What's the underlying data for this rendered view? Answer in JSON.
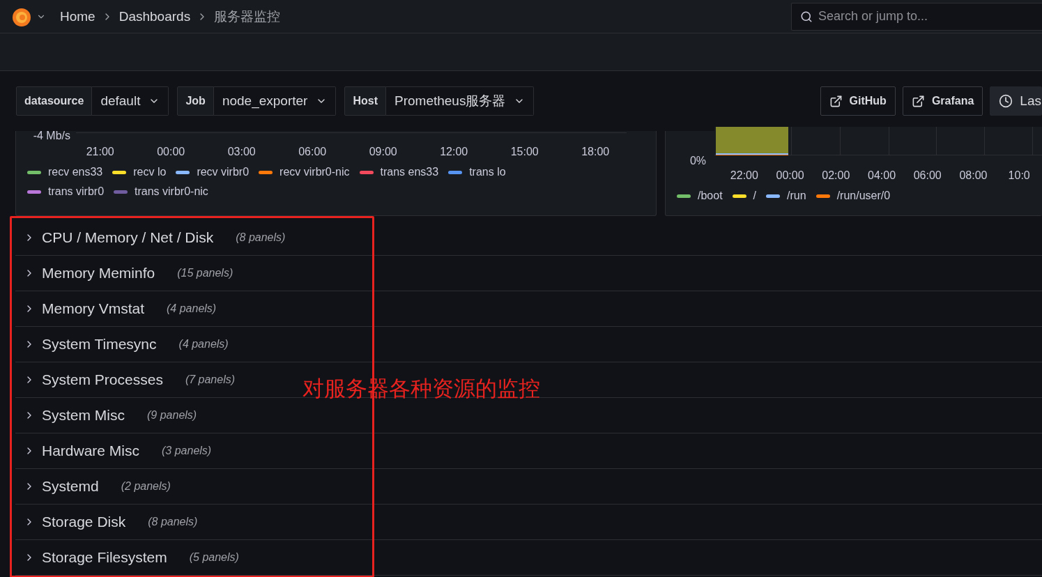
{
  "breadcrumbs": [
    {
      "label": "Home",
      "current": false
    },
    {
      "label": "Dashboards",
      "current": false
    },
    {
      "label": "服务器监控",
      "current": true
    }
  ],
  "search": {
    "placeholder": "Search or jump to..."
  },
  "variables": [
    {
      "label": "datasource",
      "value": "default"
    },
    {
      "label": "Job",
      "value": "node_exporter"
    },
    {
      "label": "Host",
      "value": "Prometheus服务器"
    }
  ],
  "links": [
    {
      "kind": "external",
      "label": "GitHub"
    },
    {
      "kind": "external",
      "label": "Grafana"
    },
    {
      "kind": "time",
      "label": "Las"
    }
  ],
  "panels": [
    {
      "y_label": "-4 Mb/s",
      "x_ticks": [
        "21:00",
        "00:00",
        "03:00",
        "06:00",
        "09:00",
        "12:00",
        "15:00",
        "18:00"
      ],
      "legend": [
        {
          "label": "recv ens33",
          "color": "#73bf69"
        },
        {
          "label": "recv lo",
          "color": "#fade2a"
        },
        {
          "label": "recv virbr0",
          "color": "#8ab8ff"
        },
        {
          "label": "recv virbr0-nic",
          "color": "#ff780a"
        },
        {
          "label": "trans ens33",
          "color": "#f2495c"
        },
        {
          "label": "trans lo",
          "color": "#5794f2"
        },
        {
          "label": "trans virbr0",
          "color": "#b877d9"
        },
        {
          "label": "trans virbr0-nic",
          "color": "#705da0"
        }
      ]
    },
    {
      "y_label": "0%",
      "x_ticks": [
        "22:00",
        "00:00",
        "02:00",
        "04:00",
        "06:00",
        "08:00",
        "10:0"
      ],
      "legend": [
        {
          "label": "/boot",
          "color": "#73bf69"
        },
        {
          "label": "/",
          "color": "#fade2a"
        },
        {
          "label": "/run",
          "color": "#8ab8ff"
        },
        {
          "label": "/run/user/0",
          "color": "#ff780a"
        }
      ]
    }
  ],
  "rows": [
    {
      "title": "CPU / Memory / Net / Disk",
      "count": "(8 panels)",
      "expanded": false
    },
    {
      "title": "Memory Meminfo",
      "count": "(15 panels)",
      "expanded": false
    },
    {
      "title": "Memory Vmstat",
      "count": "(4 panels)",
      "expanded": false
    },
    {
      "title": "System Timesync",
      "count": "(4 panels)",
      "expanded": false
    },
    {
      "title": "System Processes",
      "count": "(7 panels)",
      "expanded": false
    },
    {
      "title": "System Misc",
      "count": "(9 panels)",
      "expanded": false
    },
    {
      "title": "Hardware Misc",
      "count": "(3 panels)",
      "expanded": false
    },
    {
      "title": "Systemd",
      "count": "(2 panels)",
      "expanded": false
    },
    {
      "title": "Storage Disk",
      "count": "(8 panels)",
      "expanded": false
    },
    {
      "title": "Storage Filesystem",
      "count": "(5 panels)",
      "expanded": false
    }
  ],
  "annotation": {
    "text": "对服务器各种资源的监控"
  }
}
